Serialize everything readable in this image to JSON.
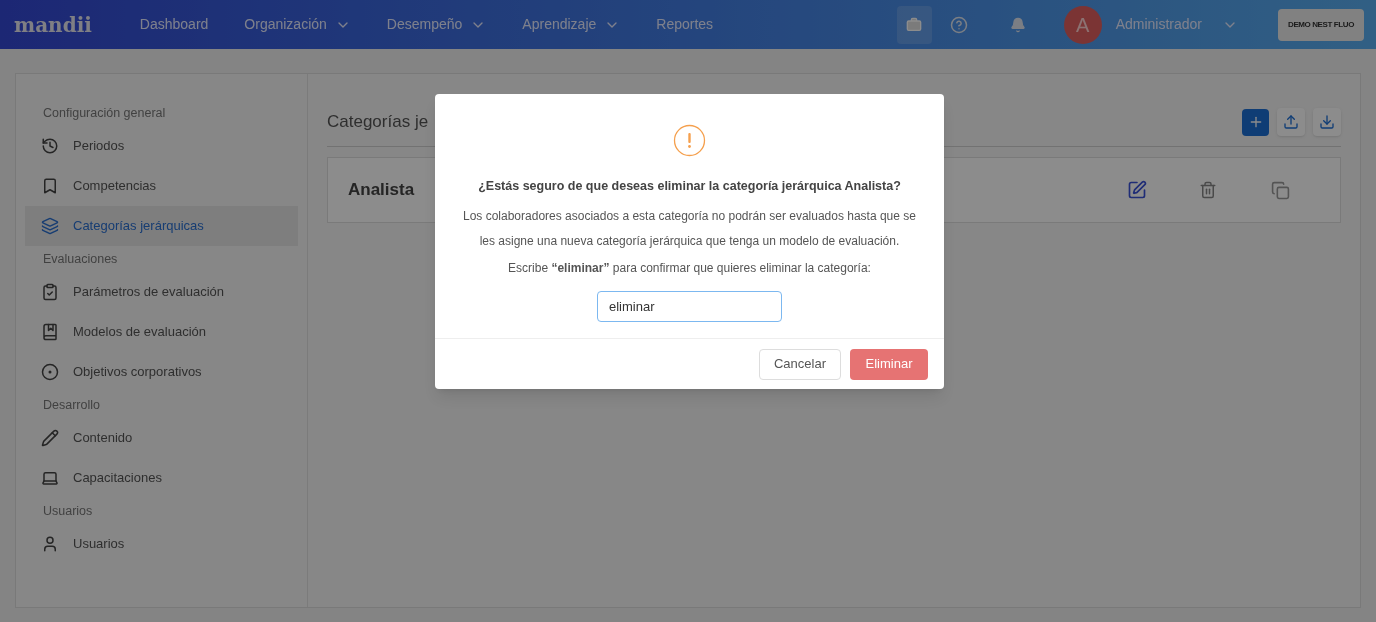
{
  "navbar": {
    "logo": "mandii",
    "items": [
      {
        "label": "Dashboard",
        "kind": "link"
      },
      {
        "label": "Organización",
        "kind": "dropdown"
      },
      {
        "label": "Desempeño",
        "kind": "dropdown"
      },
      {
        "label": "Aprendizaje",
        "kind": "dropdown"
      },
      {
        "label": "Reportes",
        "kind": "link"
      }
    ],
    "user": {
      "initial": "A",
      "name": "Administrador"
    },
    "company_button": "DEMO NEST FLUO"
  },
  "sidebar": {
    "sections": [
      {
        "title": "Configuración general",
        "items": [
          {
            "label": "Periodos",
            "selected": false
          },
          {
            "label": "Competencias",
            "selected": false
          },
          {
            "label": "Categorías jerárquicas",
            "selected": true
          }
        ]
      },
      {
        "title": "Evaluaciones",
        "items": [
          {
            "label": "Parámetros de evaluación",
            "selected": false
          },
          {
            "label": "Modelos de evaluación",
            "selected": false
          },
          {
            "label": "Objetivos corporativos",
            "selected": false
          }
        ]
      },
      {
        "title": "Desarrollo",
        "items": [
          {
            "label": "Contenido",
            "selected": false
          },
          {
            "label": "Capacitaciones",
            "selected": false
          }
        ]
      },
      {
        "title": "Usuarios",
        "items": [
          {
            "label": "Usuarios",
            "selected": false
          }
        ]
      }
    ]
  },
  "page": {
    "title": "Categorías je",
    "categories": [
      {
        "name": "Analista"
      }
    ]
  },
  "dialog": {
    "title": "¿Estás seguro de que deseas eliminar la categoría jerárquica Analista?",
    "message": "Los colaboradores asociados a esta categoría no podrán ser evaluados hasta que se les asigne una nueva categoría jerárquica que tenga un modelo de evaluación.",
    "instruction": "Escribe **“eliminar”** para confirmar que quieres eliminar la categoría:",
    "input": {
      "value": "eliminar"
    },
    "buttons": [
      {
        "label": "Cancelar",
        "kind": "secondary"
      },
      {
        "label": "Eliminar",
        "kind": "danger"
      }
    ]
  }
}
